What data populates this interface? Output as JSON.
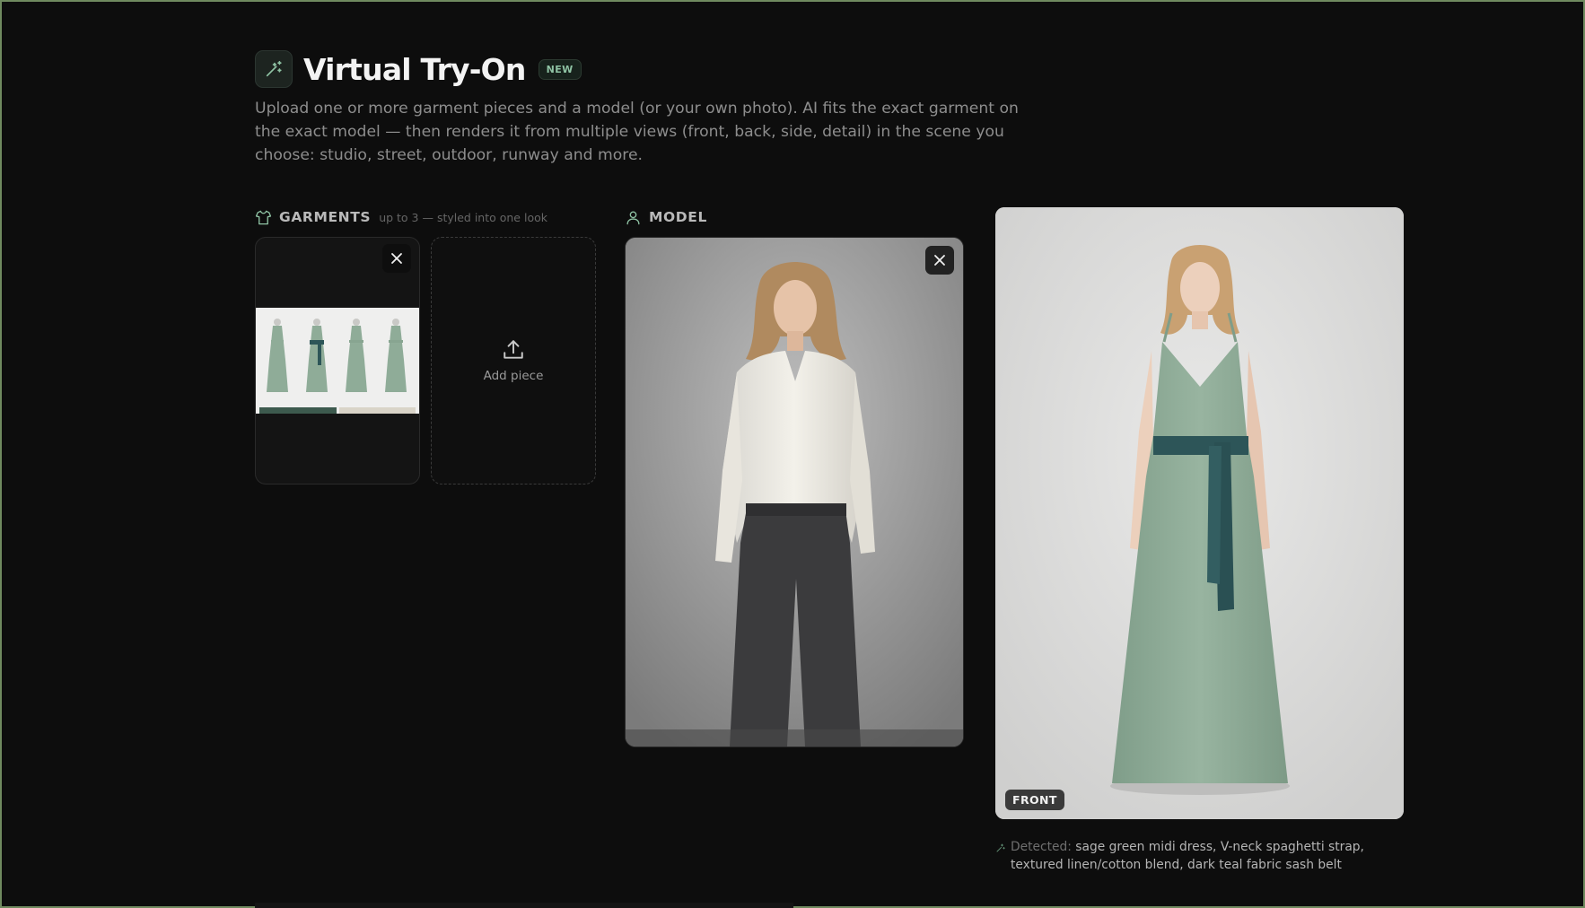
{
  "header": {
    "title": "Virtual Try-On",
    "badge": "NEW",
    "description": "Upload one or more garment pieces and a model (or your own photo). AI fits the exact garment on the exact model — then renders it from multiple views (front, back, side, detail) in the scene you choose: studio, street, outdoor, runway and more."
  },
  "garments": {
    "label": "GARMENTS",
    "hint": "up to 3 — styled into one look",
    "add_label": "Add piece"
  },
  "model": {
    "label": "MODEL"
  },
  "result": {
    "view_badge": "FRONT",
    "detected_label": "Detected:",
    "detected_text": "sage green midi dress, V-neck spaghetti strap, textured linen/cotton blend, dark teal fabric sash belt"
  },
  "colors": {
    "accent": "#8fc3a4",
    "dress": "#8fac98",
    "sash": "#2d5558"
  },
  "icons": {
    "title": "magic-wand-icon",
    "garments": "shirt-icon",
    "model": "user-icon",
    "upload": "upload-icon",
    "close": "close-icon",
    "detected": "sparkle-icon"
  }
}
